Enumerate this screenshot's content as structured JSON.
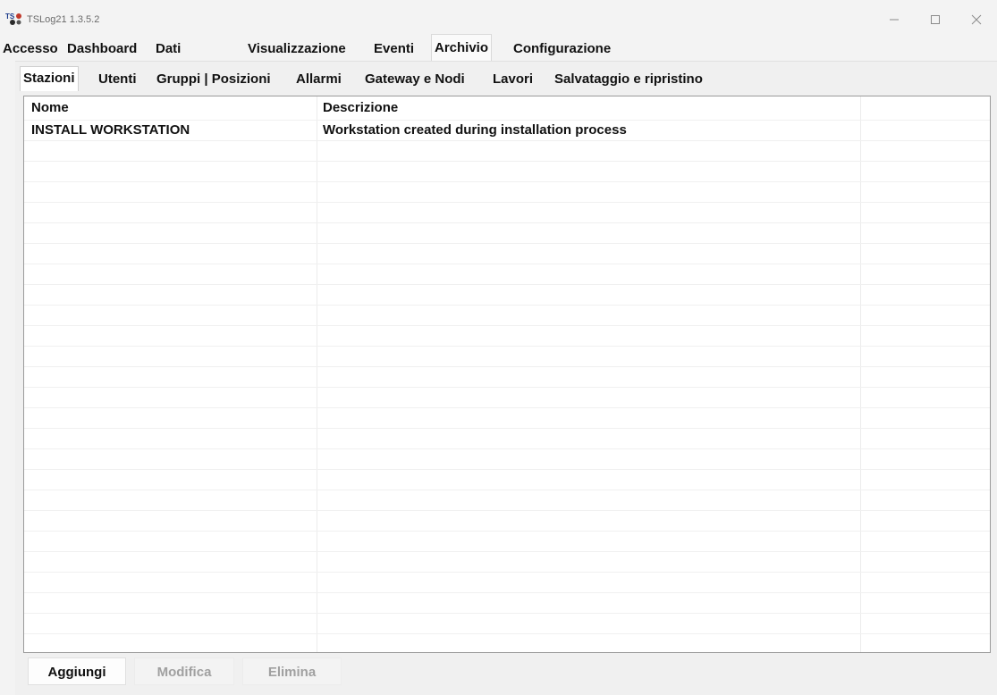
{
  "window": {
    "title": "TSLog21  1.3.5.2",
    "icon": "tslog-app-icon",
    "controls": [
      "minimize-icon",
      "maximize-icon",
      "close-icon"
    ]
  },
  "main_tabs": [
    {
      "label": "Accesso",
      "active": false
    },
    {
      "label": "Dashboard",
      "active": false
    },
    {
      "label": "Dati",
      "active": false
    },
    {
      "label": "Visualizzazione",
      "active": false
    },
    {
      "label": "Eventi",
      "active": false
    },
    {
      "label": "Archivio",
      "active": true
    },
    {
      "label": "Configurazione",
      "active": false
    }
  ],
  "sub_tabs": [
    {
      "label": "Stazioni",
      "active": true
    },
    {
      "label": "Utenti",
      "active": false
    },
    {
      "label": "Gruppi | Posizioni",
      "active": false
    },
    {
      "label": "Allarmi",
      "active": false
    },
    {
      "label": "Gateway e Nodi",
      "active": false
    },
    {
      "label": "Lavori",
      "active": false
    },
    {
      "label": "Salvataggio e ripristino",
      "active": false
    }
  ],
  "table": {
    "columns": [
      "Nome",
      "Descrizione",
      ""
    ],
    "rows": [
      [
        "INSTALL WORKSTATION",
        "Workstation created during installation process",
        ""
      ]
    ]
  },
  "buttons": [
    {
      "label": "Aggiungi",
      "enabled": true
    },
    {
      "label": "Modifica",
      "enabled": false
    },
    {
      "label": "Elimina",
      "enabled": false
    }
  ]
}
